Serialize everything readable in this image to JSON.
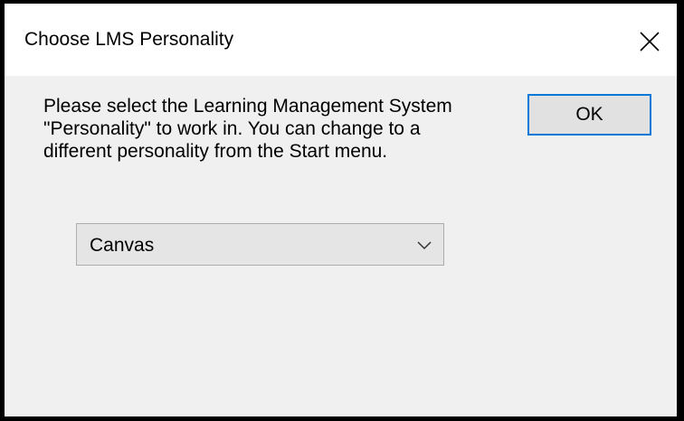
{
  "dialog": {
    "title": "Choose LMS Personality",
    "message": "Please select the Learning Management System\n\"Personality\" to work in.  You can change to a\ndifferent personality from the Start menu.",
    "ok_label": "OK",
    "personality_select": {
      "selected": "Canvas"
    },
    "icons": {
      "close": "close-icon",
      "dropdown": "chevron-down-icon"
    }
  }
}
